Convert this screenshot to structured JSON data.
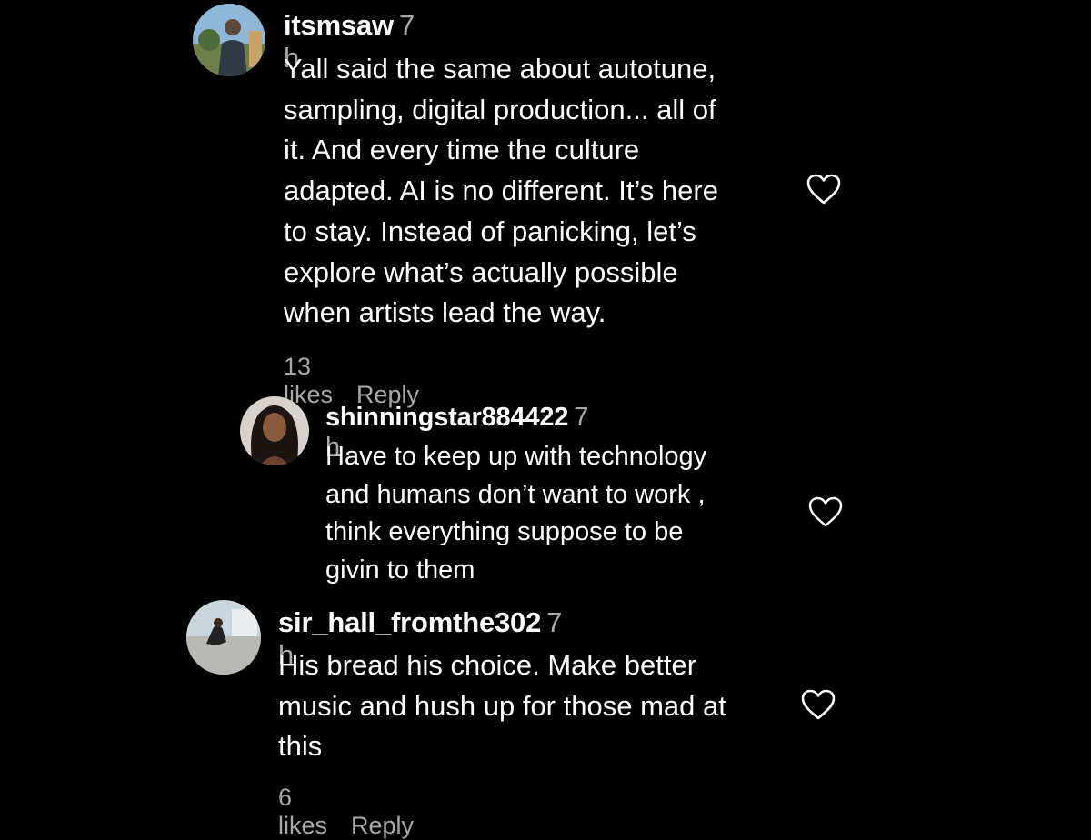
{
  "comments": [
    {
      "username": "itsmsaw",
      "time": "7 h",
      "lines": [
        "Yall said the same about autotune,",
        "sampling, digital production... all of",
        "it. And every time the culture",
        "adapted. AI is no different. It’s here",
        "to stay. Instead of panicking, let’s",
        "explore what’s actually possible",
        "when artists lead the way."
      ],
      "likes": "13 likes",
      "reply_label": "Reply",
      "like_icon": "heart-outline-icon"
    },
    {
      "username": "shinningstar884422",
      "time": "7 h",
      "lines": [
        "Have to keep up with technology",
        "and humans don’t want to work ,",
        "think everything suppose to be",
        "givin to them"
      ],
      "like_icon": "heart-outline-icon"
    },
    {
      "username": "sir_hall_fromthe302",
      "time": "7 h",
      "lines": [
        "His bread his choice. Make better",
        "music and hush up for those mad at",
        "this"
      ],
      "likes": "6 likes",
      "reply_label": "Reply",
      "like_icon": "heart-outline-icon"
    }
  ],
  "colors": {
    "background": "#000000",
    "text": "#ffffff",
    "secondary_text": "#a8a8a8"
  }
}
